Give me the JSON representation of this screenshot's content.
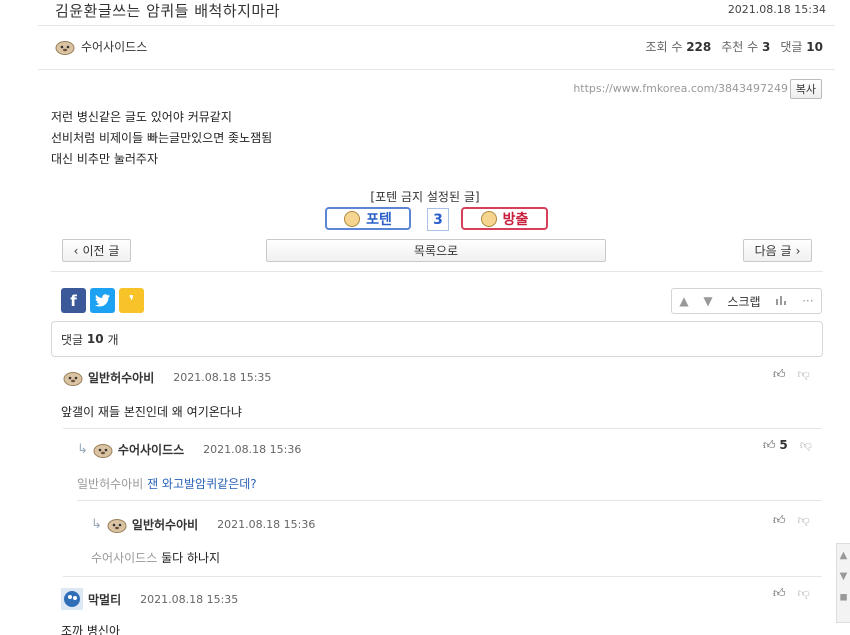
{
  "post": {
    "title": "김윤환글쓰는 암퀴들 배척하지마라",
    "date": "2021.08.18 15:34",
    "author": "수어사이드스",
    "views_label": "조회 수",
    "views": "228",
    "recommend_label": "추천 수",
    "recommend": "3",
    "comments_label": "댓글",
    "comments": "10",
    "url": "https://www.fmkorea.com/3843497249",
    "copy_label": "복사",
    "content_lines": [
      "저런 병신같은 글도 있어야 커뮤같지",
      "선비처럼 비제이들 빠는글만있으면 좆노잼됨",
      "대신 비추만 눌러주자"
    ]
  },
  "vote": {
    "banned_label": "[포텐 금지 설정된 글]",
    "up_label": "포텐",
    "count": "3",
    "down_label": "방출"
  },
  "nav": {
    "prev_label": "이전 글",
    "list_label": "목록으로",
    "next_label": "다음 글"
  },
  "share": {
    "facebook": "f",
    "kakao": "❜",
    "scrap_label": "스크랩"
  },
  "comments_box": {
    "label": "댓글",
    "count": "10",
    "unit": "개"
  },
  "comments": [
    {
      "name": "일반허수아비",
      "date": "2021.08.18 15:35",
      "text": "앞갤이 재들 본진인데 왜 여기온다냐",
      "likes": ""
    },
    {
      "name": "수어사이드스",
      "date": "2021.08.18 15:36",
      "mention": "일반허수아비",
      "text": "잰 와고발암퀴같은데?",
      "likes": "5"
    },
    {
      "name": "일반허수아비",
      "date": "2021.08.18 15:36",
      "mention": "수어사이드스",
      "text": "둘다 하나지",
      "likes": ""
    },
    {
      "name": "막멀티",
      "date": "2021.08.18 15:35",
      "text": "조까 병신아",
      "likes": ""
    }
  ],
  "colors": {
    "facebook": "#3b5998",
    "twitter": "#1da1f2",
    "kakao": "#f7c329",
    "up_border": "#5b86d6",
    "down_border": "#d6405a"
  }
}
